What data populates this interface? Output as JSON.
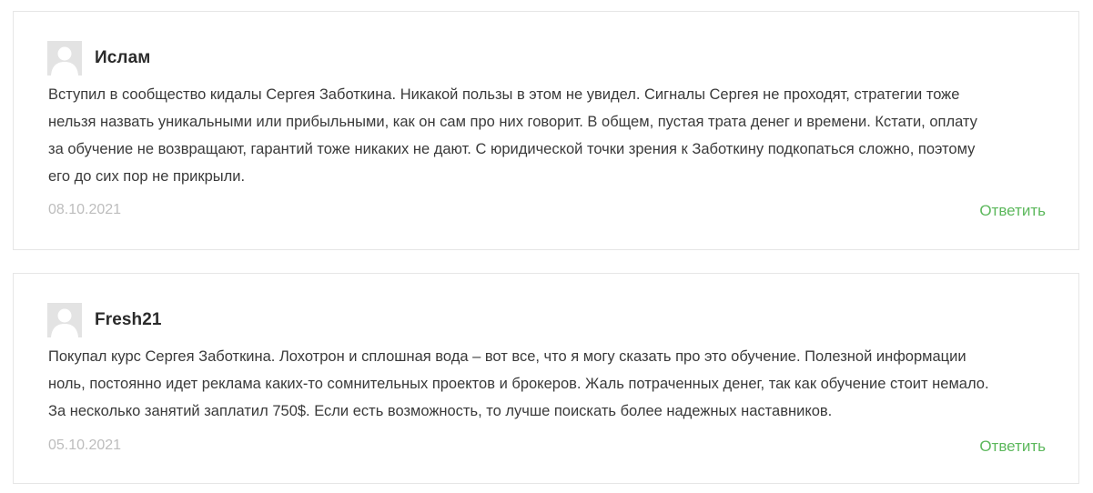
{
  "comments": [
    {
      "author": "Ислам",
      "avatar_icon": "user-placeholder-icon",
      "text_lines": [
        "Вступил в сообщество кидалы Сергея Заботкина. Никакой пользы в этом не увидел. Сигналы Сергея не проходят, стратегии тоже",
        "нельзя назвать уникальными или прибыльными, как он сам про них говорит. В общем, пустая трата денег и времени. Кстати, оплату",
        "за обучение не возвращают, гарантий тоже никаких не дают. С юридической точки зрения к Заботкину подкопаться сложно, поэтому",
        "его до сих пор не прикрыли."
      ],
      "date": "08.10.2021",
      "reply_label": "Ответить"
    },
    {
      "author": "Fresh21",
      "avatar_icon": "user-placeholder-icon",
      "text_lines": [
        "Покупал курс Сергея Заботкина. Лохотрон и сплошная вода – вот все, что я могу сказать про это обучение. Полезной информации",
        "ноль, постоянно идет реклама каких-то сомнительных проектов и брокеров. Жаль потраченных денег, так как обучение стоит немало.",
        "За несколько занятий заплатил 750$. Если есть возможность, то лучше поискать более надежных наставников."
      ],
      "date": "05.10.2021",
      "reply_label": "Ответить"
    }
  ],
  "colors": {
    "reply_link": "#5cb85c",
    "date_text": "#bdbdbd",
    "body_text": "#3a3a3a",
    "author_text": "#2b2b2b",
    "avatar_bg": "#e3e3e3",
    "card_border": "#e6e6e6"
  }
}
